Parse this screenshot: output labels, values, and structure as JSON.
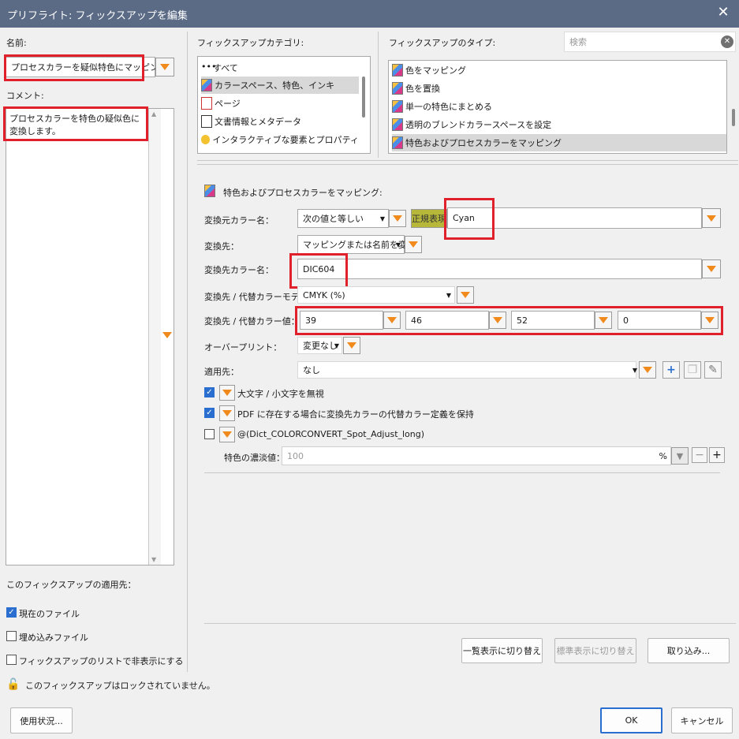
{
  "window": {
    "title": "プリフライト: フィックスアップを編集",
    "close_glyph": "✕"
  },
  "left": {
    "name_label": "名前:",
    "name_value": "プロセスカラーを疑似特色にマッピング",
    "comment_label": "コメント:",
    "comment_value": "プロセスカラーを特色の疑似色に変換します。",
    "applies_label": "このフィックスアップの適用先：",
    "current_file": "現在のファイル",
    "embedded_files": "埋め込みファイル",
    "hide_in_list": "フィックスアップのリストで非表示にする",
    "lock_status": "このフィックスアップはロックされていません。",
    "usage_button": "使用状況..."
  },
  "categories": {
    "label": "フィックスアップカテゴリ:",
    "items": [
      {
        "label": "すべて",
        "icon": "dots-icon"
      },
      {
        "label": "カラースペース、特色、インキ",
        "icon": "fixup-icon"
      },
      {
        "label": "ページ",
        "icon": "pdf-page-icon"
      },
      {
        "label": "文書情報とメタデータ",
        "icon": "document-icon"
      },
      {
        "label": "インタラクティブな要素とプロパティ",
        "icon": "bubble-icon"
      }
    ]
  },
  "types": {
    "label": "フィックスアップのタイプ:",
    "search_placeholder": "検索",
    "items": [
      {
        "label": "色をマッピング"
      },
      {
        "label": "色を置換"
      },
      {
        "label": "単一の特色にまとめる"
      },
      {
        "label": "透明のブレンドカラースペースを設定"
      },
      {
        "label": "特色およびプロセスカラーをマッピング"
      }
    ]
  },
  "detail": {
    "header": "特色およびプロセスカラーをマッピング:",
    "source_label": "変換元カラー名：",
    "source_condition": "次の値と等しい",
    "regex_tag": "正規表現",
    "source_value": "Cyan",
    "dest_label": "変換先：",
    "dest_value": "マッピングまたは名前を変更",
    "dest_name_label": "変換先カラー名：",
    "dest_name_value": "DIC604",
    "alt_model_label": "変換先 / 代替カラーモデル：",
    "alt_model_value": "CMYK (%)",
    "alt_values_label": "変換先 / 代替カラー値：",
    "alt_values": [
      "39",
      "46",
      "52",
      "0"
    ],
    "overprint_label": "オーバープリント：",
    "overprint_value": "変更なし",
    "apply_to_label": "適用先：",
    "apply_to_value": "なし",
    "ignore_case": "大文字 / 小文字を無視",
    "keep_alt": "PDF に存在する場合に変換先カラーの代替カラー定義を保持",
    "spot_adjust": "@(Dict_COLORCONVERT_Spot_Adjust_long)",
    "tint_label": "特色の濃淡値：",
    "tint_placeholder": "100",
    "tint_unit": "%"
  },
  "buttons": {
    "list_view": "一覧表示に切り替え",
    "std_view": "標準表示に切り替え",
    "import": "取り込み...",
    "ok": "OK",
    "cancel": "キャンセル"
  }
}
